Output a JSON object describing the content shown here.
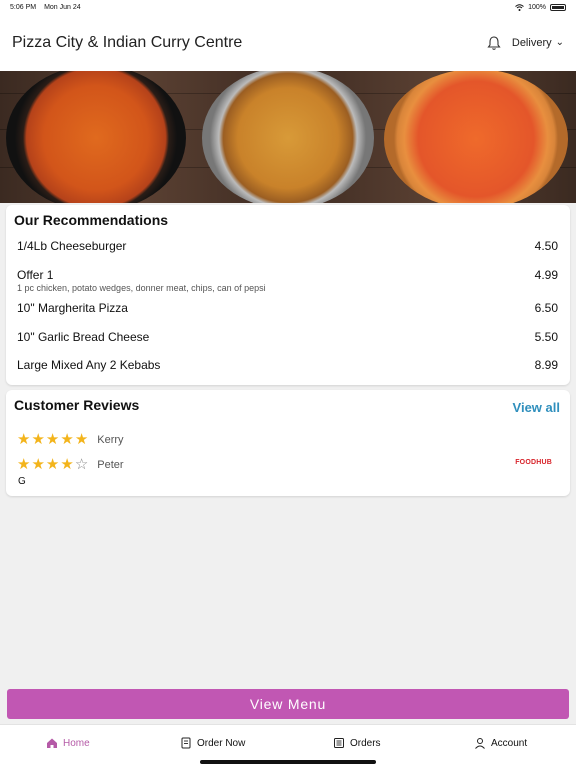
{
  "status": {
    "time": "5:06 PM",
    "date": "Mon Jun 24",
    "battery": "100%"
  },
  "header": {
    "title": "Pizza City & Indian Curry Centre",
    "delivery_label": "Delivery"
  },
  "recommendations": {
    "title": "Our Recommendations",
    "items": [
      {
        "name": "1/4Lb Cheeseburger",
        "price": "4.50",
        "desc": ""
      },
      {
        "name": "Offer 1",
        "price": "4.99",
        "desc": "1 pc chicken, potato wedges, donner meat, chips, can of pepsi"
      },
      {
        "name": "10\" Margherita Pizza",
        "price": "6.50",
        "desc": ""
      },
      {
        "name": "10\" Garlic Bread Cheese",
        "price": "5.50",
        "desc": ""
      },
      {
        "name": "Large Mixed Any 2 Kebabs",
        "price": "8.99",
        "desc": ""
      }
    ]
  },
  "reviews": {
    "title": "Customer Reviews",
    "view_all": "View all",
    "items": [
      {
        "name": "Kerry",
        "rating": 5,
        "text": ""
      },
      {
        "name": "Peter",
        "rating": 4,
        "text": "G"
      }
    ],
    "brand": "FOODHUB"
  },
  "view_menu_label": "View Menu",
  "tabs": [
    {
      "label": "Home",
      "icon": "home-icon",
      "active": true
    },
    {
      "label": "Order Now",
      "icon": "order-icon",
      "active": false
    },
    {
      "label": "Orders",
      "icon": "orders-icon",
      "active": false
    },
    {
      "label": "Account",
      "icon": "account-icon",
      "active": false
    }
  ],
  "colors": {
    "accent": "#c157b3",
    "link": "#2f8fbd",
    "star": "#f3b41b"
  }
}
